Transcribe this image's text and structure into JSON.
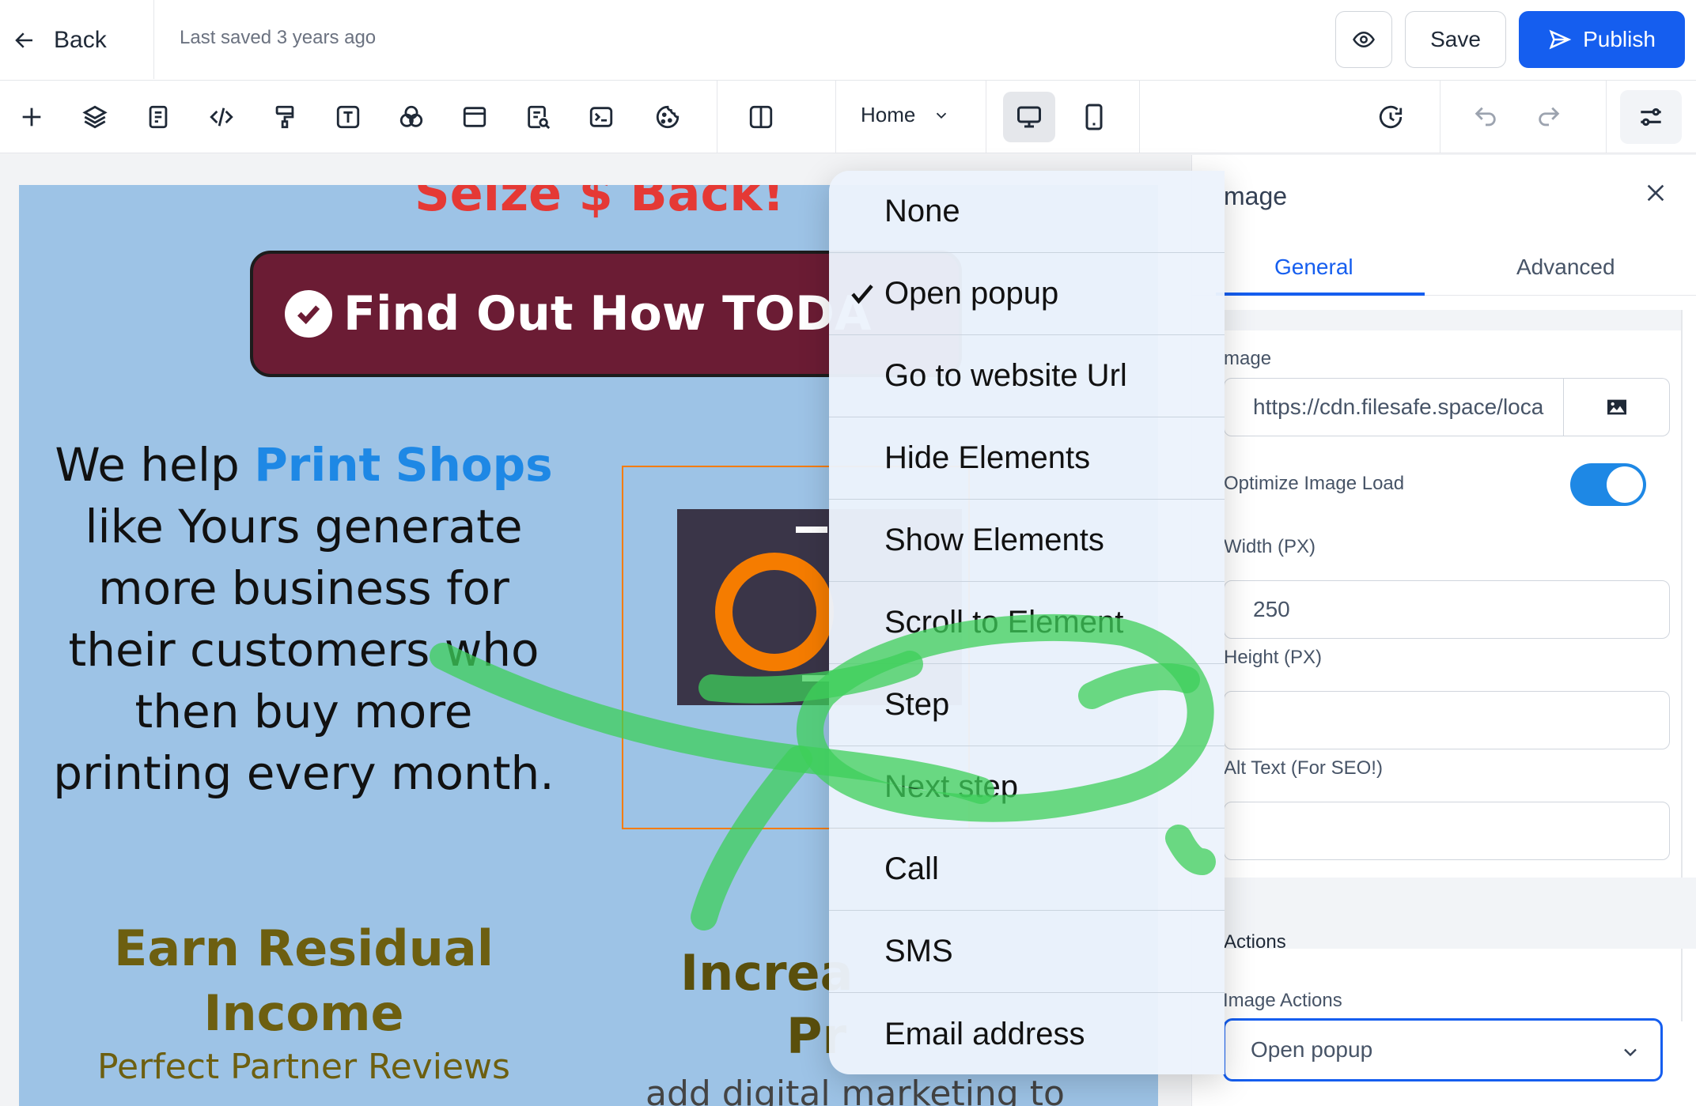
{
  "header": {
    "back_label": "Back",
    "saved_text": "Last saved 3 years ago",
    "save_label": "Save",
    "publish_label": "Publish"
  },
  "toolbar": {
    "page_select": "Home",
    "tools": [
      "add-icon",
      "layers-icon",
      "pages-icon",
      "code-icon",
      "paint-roller-icon",
      "text-icon",
      "color-circles-icon",
      "section-icon",
      "seo-page-icon",
      "terminal-icon",
      "cookie-icon",
      "split-view-icon"
    ],
    "devices": [
      "desktop",
      "mobile"
    ],
    "active_device": "desktop"
  },
  "canvas": {
    "top_heading": "Seize $ Back!",
    "cta_label": "Find Out How TODA",
    "intro": {
      "prefix": "We help ",
      "highlight1": "Print",
      "highlight2": "Shops",
      "rest": " like Yours generate more business for their customers who then buy more printing every month."
    },
    "earn_line1": "Earn Residual",
    "earn_line2": "Income",
    "partner_text": "Perfect Partner Reviews",
    "increase_line1": "Increa",
    "increase_line2": "Pr",
    "add_text": "add digital marketing to"
  },
  "panel": {
    "title": "mage",
    "tabs": [
      "General",
      "Advanced"
    ],
    "active_tab": "General",
    "image_label": "mage",
    "image_url": "https://cdn.filesafe.space/loca",
    "optimize_label": "Optimize Image Load",
    "optimize_on": true,
    "width_label": "Width (PX)",
    "width_value": "250",
    "height_label": "Height (PX)",
    "height_value": "",
    "alt_label": "Alt Text (For SEO!)",
    "alt_value": "",
    "actions_title": "Actions",
    "image_actions_label": "Image Actions",
    "image_actions_value": "Open popup"
  },
  "menu": {
    "items": [
      "None",
      "Open popup",
      "Go to website Url",
      "Hide Elements",
      "Show Elements",
      "Scroll to Element",
      "Step",
      "Next step",
      "Call",
      "SMS",
      "Email address"
    ],
    "selected": "Open popup"
  },
  "colors": {
    "accent": "#155eef",
    "canvas_bg": "#9dc3e6",
    "cta_bg": "#6b1c34",
    "heading_red": "#e53935",
    "earn_gold": "#6d5f10",
    "scribble_green": "#3ecf5a"
  }
}
